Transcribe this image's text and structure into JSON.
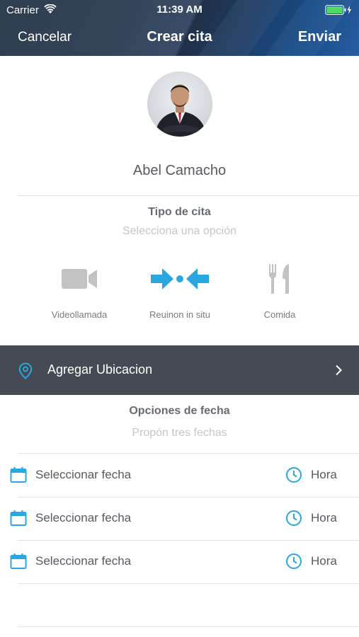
{
  "status_bar": {
    "carrier": "Carrier",
    "time": "11:39 AM"
  },
  "nav": {
    "cancel_label": "Cancelar",
    "title": "Crear cita",
    "send_label": "Enviar"
  },
  "profile": {
    "name": "Abel Camacho"
  },
  "appointment_type": {
    "title": "Tipo de cita",
    "subtitle": "Selecciona una opción",
    "options": [
      {
        "label": "Videollamada",
        "icon": "video-camera-icon",
        "selected": false
      },
      {
        "label": "Reuinon in situ",
        "icon": "meeting-arrows-icon",
        "selected": true
      },
      {
        "label": "Comida",
        "icon": "fork-knife-icon",
        "selected": false
      }
    ]
  },
  "location": {
    "label": "Agregar Ubicacion",
    "icon": "location-pin-icon"
  },
  "date_options": {
    "title": "Opciones de fecha",
    "subtitle": "Propón tres fechas",
    "rows": [
      {
        "date_label": "Seleccionar fecha",
        "time_label": "Hora"
      },
      {
        "date_label": "Seleccionar fecha",
        "time_label": "Hora"
      },
      {
        "date_label": "Seleccionar fecha",
        "time_label": "Hora"
      }
    ]
  },
  "colors": {
    "accent": "#29a8e0",
    "inactive_icon": "#c2c2c2",
    "location_bar": "#454b54",
    "header": "#1d3d66"
  }
}
